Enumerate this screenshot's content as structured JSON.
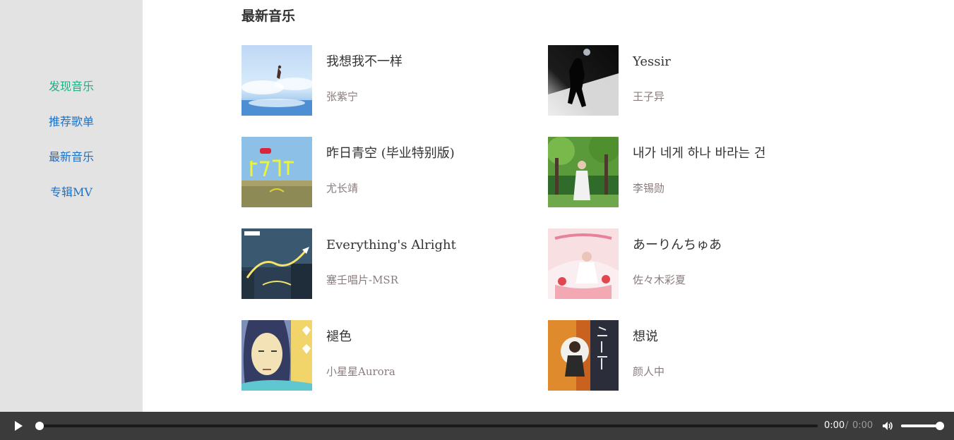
{
  "sidebar": {
    "items": [
      {
        "label": "发现音乐",
        "active": true
      },
      {
        "label": "推荐歌单",
        "active": false
      },
      {
        "label": "最新音乐",
        "active": false
      },
      {
        "label": "专辑MV",
        "active": false
      }
    ]
  },
  "main": {
    "section_title": "最新音乐",
    "songs": [
      {
        "title": "我想我不一样",
        "artist": "张紫宁",
        "cover": "sky-girl-cover"
      },
      {
        "title": "Yessir",
        "artist": "王子异",
        "cover": "silhouette-cover"
      },
      {
        "title": "昨日青空 (毕业特别版)",
        "artist": "尤长靖",
        "cover": "field-cover"
      },
      {
        "title": "내가 네게 하나 바라는 건",
        "artist": "李锡勋",
        "cover": "forest-cover"
      },
      {
        "title": "Everything's Alright",
        "artist": "塞壬唱片-MSR",
        "cover": "night-city-cover"
      },
      {
        "title": "あーりんちゅあ",
        "artist": "佐々木彩夏",
        "cover": "pink-cake-cover"
      },
      {
        "title": "褪色",
        "artist": "小星星Aurora",
        "cover": "illustration-cover"
      },
      {
        "title": "想说",
        "artist": "颜人中",
        "cover": "orange-portrait-cover"
      }
    ]
  },
  "player": {
    "play_icon": "play-icon",
    "current_time": "0:00",
    "separator": "/",
    "total_time": "0:00",
    "progress": 0,
    "volume_icon": "volume-icon",
    "volume": 1.0
  },
  "colors": {
    "sidebar_bg": "#e3e3e3",
    "nav_link": "#1c72c9",
    "nav_active": "#1fae86",
    "player_bg": "#3b3b3b"
  }
}
